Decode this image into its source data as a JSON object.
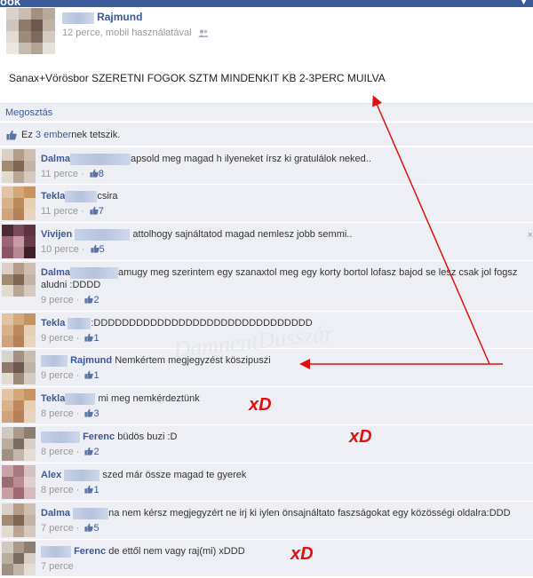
{
  "topbar": {
    "brand": "ook",
    "menu_icon": "chevron-down-icon"
  },
  "post": {
    "author": "Rajmund",
    "meta": "12 perce, mobil használatával",
    "audience_icon": "friends-icon",
    "text": "Sanax+Vörösbor SZERETNI FOGOK SZTM MINDENKIT KB 2-3PERC MUILVA"
  },
  "share": {
    "label": "Megosztás"
  },
  "likes": {
    "prefix": "Ez ",
    "link": "3 ember",
    "suffix": "nek tetszik."
  },
  "comments": [
    {
      "author": "Dalma",
      "text": "apsold meg magad h ilyeneket írsz ki gratulálok neked..",
      "time": "11 perce",
      "likes": "8"
    },
    {
      "author": "Tekla",
      "text": "csira",
      "time": "11 perce",
      "likes": "7"
    },
    {
      "author": "Vivijen",
      "text": "attolhogy sajnáltatod magad nemlesz jobb semmi..",
      "time": "10 perce",
      "likes": "5"
    },
    {
      "author": "Dalma",
      "text": "amugy meg szerintem egy szanaxtol meg egy korty bortol lofasz bajod se lesz csak jol fogsz aludni :DDDD",
      "time": "9 perce",
      "likes": "2"
    },
    {
      "author": "Tekla",
      "text": ":DDDDDDDDDDDDDDDDDDDDDDDDDDDDDDD",
      "time": "9 perce",
      "likes": "1"
    },
    {
      "author": "Rajmund",
      "text": "Nemkértem megjegyzést köszipuszi",
      "time": "9 perce",
      "likes": "1"
    },
    {
      "author": "Tekla",
      "text": "mi meg nemkérdeztünk",
      "time": "8 perce",
      "likes": "3"
    },
    {
      "author": "Ferenc",
      "text": "büdös buzi :D",
      "time": "8 perce",
      "likes": "2"
    },
    {
      "author": "Alex",
      "text": "szed már össze magad te gyerek",
      "time": "8 perce",
      "likes": "1"
    },
    {
      "author": "Dalma",
      "text": "na nem kérsz megjegyzért ne irj ki iylen önsajnáltato faszságokat egy közösségi oldalra:DDD",
      "time": "7 perce",
      "likes": "5"
    },
    {
      "author": "Ferenc",
      "text": "de ettől nem vagy raj(mi) xDDD",
      "time": "7 perce",
      "likes": ""
    }
  ],
  "annotations": {
    "xd1": "xD",
    "xd2": "xD",
    "xd3": "xD",
    "arrow_color": "#e01010"
  },
  "watermark": "DamnentDusszár",
  "close_label": "×"
}
